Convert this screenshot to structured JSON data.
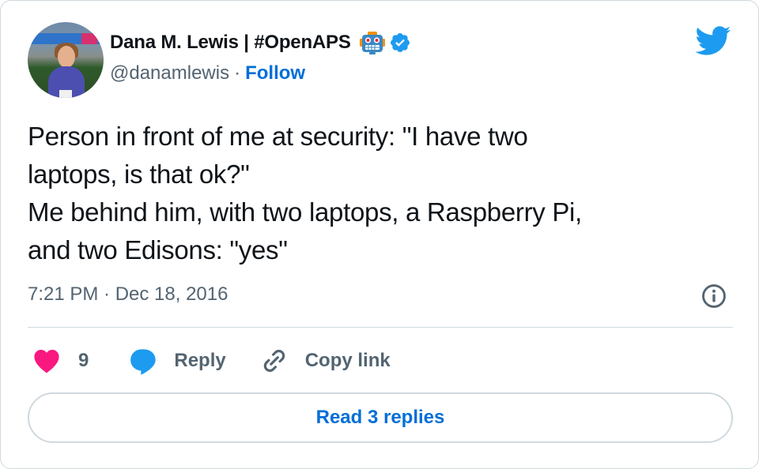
{
  "author": {
    "display_name": "Dana M. Lewis | #OpenAPS",
    "handle": "@danamlewis",
    "separator": "·",
    "follow_label": "Follow",
    "emoji": "robot-face",
    "verified": true
  },
  "tweet": {
    "text": "Person in front of me at security: \"I have two\nlaptops, is that ok?\"\nMe behind him, with two laptops, a Raspberry Pi,\nand two Edisons: \"yes\"",
    "timestamp": "7:21 PM · Dec 18, 2016"
  },
  "actions": {
    "like_count": "9",
    "reply_label": "Reply",
    "copy_link_label": "Copy link"
  },
  "read_replies_label": "Read 3 replies",
  "icons": {
    "brand": "twitter-bird-icon",
    "info": "info-icon",
    "like": "heart-icon",
    "reply": "speech-bubble-icon",
    "copy": "link-icon"
  },
  "colors": {
    "brand_blue": "#1d9bf0",
    "link_blue": "#006fd6",
    "heart_pink": "#f91880",
    "text_primary": "#0f1419",
    "text_secondary": "#536471",
    "border": "#cfd9de"
  }
}
